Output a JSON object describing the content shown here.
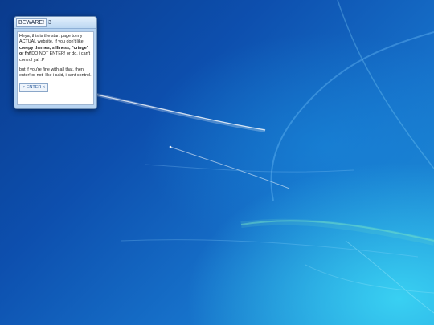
{
  "window": {
    "title": "BEWARE!",
    "title_count": "3",
    "para1_a": "Heya, this is the start page to my ACTUAL website. If you don't like ",
    "para1_bold": "creepy themes, silliness, \"cringe\" or fnf",
    "para1_b": " DO NOT ENTER! or do. i can't control ya! :P",
    "para2": "but if you're fine with all that, then enter! or not- like i said, i cant control.",
    "enter_label": "> ENTER <"
  },
  "colors": {
    "desktop_top": "#0a3b8d",
    "desktop_glow": "#39d0f2",
    "window_frame": "#c8e1f8"
  }
}
